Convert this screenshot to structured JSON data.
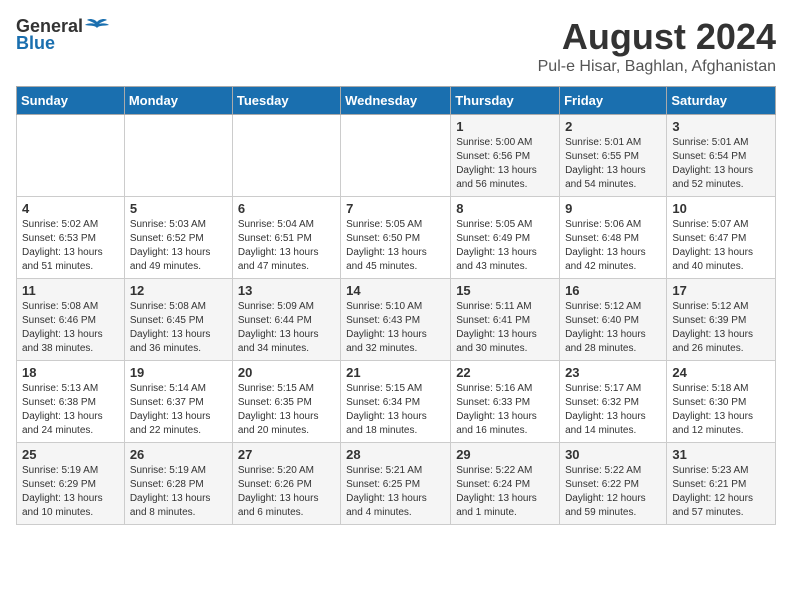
{
  "header": {
    "logo_general": "General",
    "logo_blue": "Blue",
    "month": "August 2024",
    "location": "Pul-e Hisar, Baghlan, Afghanistan"
  },
  "weekdays": [
    "Sunday",
    "Monday",
    "Tuesday",
    "Wednesday",
    "Thursday",
    "Friday",
    "Saturday"
  ],
  "weeks": [
    [
      {
        "day": "",
        "info": ""
      },
      {
        "day": "",
        "info": ""
      },
      {
        "day": "",
        "info": ""
      },
      {
        "day": "",
        "info": ""
      },
      {
        "day": "1",
        "info": "Sunrise: 5:00 AM\nSunset: 6:56 PM\nDaylight: 13 hours\nand 56 minutes."
      },
      {
        "day": "2",
        "info": "Sunrise: 5:01 AM\nSunset: 6:55 PM\nDaylight: 13 hours\nand 54 minutes."
      },
      {
        "day": "3",
        "info": "Sunrise: 5:01 AM\nSunset: 6:54 PM\nDaylight: 13 hours\nand 52 minutes."
      }
    ],
    [
      {
        "day": "4",
        "info": "Sunrise: 5:02 AM\nSunset: 6:53 PM\nDaylight: 13 hours\nand 51 minutes."
      },
      {
        "day": "5",
        "info": "Sunrise: 5:03 AM\nSunset: 6:52 PM\nDaylight: 13 hours\nand 49 minutes."
      },
      {
        "day": "6",
        "info": "Sunrise: 5:04 AM\nSunset: 6:51 PM\nDaylight: 13 hours\nand 47 minutes."
      },
      {
        "day": "7",
        "info": "Sunrise: 5:05 AM\nSunset: 6:50 PM\nDaylight: 13 hours\nand 45 minutes."
      },
      {
        "day": "8",
        "info": "Sunrise: 5:05 AM\nSunset: 6:49 PM\nDaylight: 13 hours\nand 43 minutes."
      },
      {
        "day": "9",
        "info": "Sunrise: 5:06 AM\nSunset: 6:48 PM\nDaylight: 13 hours\nand 42 minutes."
      },
      {
        "day": "10",
        "info": "Sunrise: 5:07 AM\nSunset: 6:47 PM\nDaylight: 13 hours\nand 40 minutes."
      }
    ],
    [
      {
        "day": "11",
        "info": "Sunrise: 5:08 AM\nSunset: 6:46 PM\nDaylight: 13 hours\nand 38 minutes."
      },
      {
        "day": "12",
        "info": "Sunrise: 5:08 AM\nSunset: 6:45 PM\nDaylight: 13 hours\nand 36 minutes."
      },
      {
        "day": "13",
        "info": "Sunrise: 5:09 AM\nSunset: 6:44 PM\nDaylight: 13 hours\nand 34 minutes."
      },
      {
        "day": "14",
        "info": "Sunrise: 5:10 AM\nSunset: 6:43 PM\nDaylight: 13 hours\nand 32 minutes."
      },
      {
        "day": "15",
        "info": "Sunrise: 5:11 AM\nSunset: 6:41 PM\nDaylight: 13 hours\nand 30 minutes."
      },
      {
        "day": "16",
        "info": "Sunrise: 5:12 AM\nSunset: 6:40 PM\nDaylight: 13 hours\nand 28 minutes."
      },
      {
        "day": "17",
        "info": "Sunrise: 5:12 AM\nSunset: 6:39 PM\nDaylight: 13 hours\nand 26 minutes."
      }
    ],
    [
      {
        "day": "18",
        "info": "Sunrise: 5:13 AM\nSunset: 6:38 PM\nDaylight: 13 hours\nand 24 minutes."
      },
      {
        "day": "19",
        "info": "Sunrise: 5:14 AM\nSunset: 6:37 PM\nDaylight: 13 hours\nand 22 minutes."
      },
      {
        "day": "20",
        "info": "Sunrise: 5:15 AM\nSunset: 6:35 PM\nDaylight: 13 hours\nand 20 minutes."
      },
      {
        "day": "21",
        "info": "Sunrise: 5:15 AM\nSunset: 6:34 PM\nDaylight: 13 hours\nand 18 minutes."
      },
      {
        "day": "22",
        "info": "Sunrise: 5:16 AM\nSunset: 6:33 PM\nDaylight: 13 hours\nand 16 minutes."
      },
      {
        "day": "23",
        "info": "Sunrise: 5:17 AM\nSunset: 6:32 PM\nDaylight: 13 hours\nand 14 minutes."
      },
      {
        "day": "24",
        "info": "Sunrise: 5:18 AM\nSunset: 6:30 PM\nDaylight: 13 hours\nand 12 minutes."
      }
    ],
    [
      {
        "day": "25",
        "info": "Sunrise: 5:19 AM\nSunset: 6:29 PM\nDaylight: 13 hours\nand 10 minutes."
      },
      {
        "day": "26",
        "info": "Sunrise: 5:19 AM\nSunset: 6:28 PM\nDaylight: 13 hours\nand 8 minutes."
      },
      {
        "day": "27",
        "info": "Sunrise: 5:20 AM\nSunset: 6:26 PM\nDaylight: 13 hours\nand 6 minutes."
      },
      {
        "day": "28",
        "info": "Sunrise: 5:21 AM\nSunset: 6:25 PM\nDaylight: 13 hours\nand 4 minutes."
      },
      {
        "day": "29",
        "info": "Sunrise: 5:22 AM\nSunset: 6:24 PM\nDaylight: 13 hours\nand 1 minute."
      },
      {
        "day": "30",
        "info": "Sunrise: 5:22 AM\nSunset: 6:22 PM\nDaylight: 12 hours\nand 59 minutes."
      },
      {
        "day": "31",
        "info": "Sunrise: 5:23 AM\nSunset: 6:21 PM\nDaylight: 12 hours\nand 57 minutes."
      }
    ]
  ]
}
